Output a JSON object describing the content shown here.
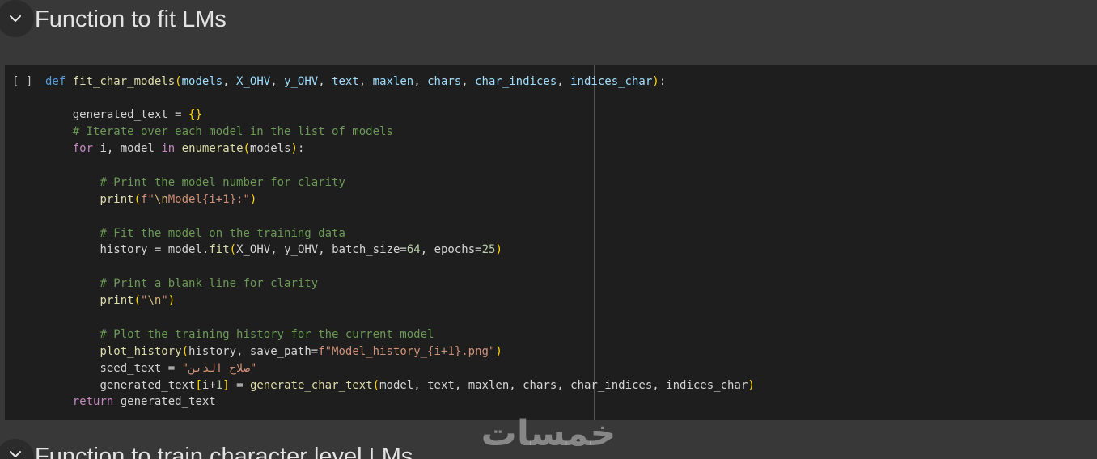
{
  "section": {
    "title": "Function to fit LMs",
    "toggle_icon": "chevron-down-icon"
  },
  "next_section": {
    "title": "Function to train character level LMs",
    "toggle_icon": "chevron-down-icon"
  },
  "cell": {
    "run_label": "[ ]",
    "lines": [
      [
        [
          "def",
          "#569cd6"
        ],
        [
          " ",
          "#d4d4d4"
        ],
        [
          "fit_char_models",
          "#dcdcaa"
        ],
        [
          "(",
          "#ffd700"
        ],
        [
          "models",
          "#9cdcfe"
        ],
        [
          ", ",
          "#d4d4d4"
        ],
        [
          "X_OHV",
          "#9cdcfe"
        ],
        [
          ", ",
          "#d4d4d4"
        ],
        [
          "y_OHV",
          "#9cdcfe"
        ],
        [
          ", ",
          "#d4d4d4"
        ],
        [
          "text",
          "#9cdcfe"
        ],
        [
          ", ",
          "#d4d4d4"
        ],
        [
          "maxlen",
          "#9cdcfe"
        ],
        [
          ", ",
          "#d4d4d4"
        ],
        [
          "chars",
          "#9cdcfe"
        ],
        [
          ", ",
          "#d4d4d4"
        ],
        [
          "char_indices",
          "#9cdcfe"
        ],
        [
          ", ",
          "#d4d4d4"
        ],
        [
          "indices_char",
          "#9cdcfe"
        ],
        [
          ")",
          "#ffd700"
        ],
        [
          ":",
          "#d4d4d4"
        ]
      ],
      [],
      [
        [
          "    ",
          "#d4d4d4"
        ],
        [
          "generated_text",
          "#d4d4d4"
        ],
        [
          " = ",
          "#d4d4d4"
        ],
        [
          "{}",
          "#ffd700"
        ]
      ],
      [
        [
          "    ",
          "#d4d4d4"
        ],
        [
          "# Iterate over each model in the list of models",
          "#6a9955"
        ]
      ],
      [
        [
          "    ",
          "#d4d4d4"
        ],
        [
          "for",
          "#c586c0"
        ],
        [
          " ",
          "#d4d4d4"
        ],
        [
          "i",
          "#d4d4d4"
        ],
        [
          ", ",
          "#d4d4d4"
        ],
        [
          "model",
          "#d4d4d4"
        ],
        [
          " ",
          "#d4d4d4"
        ],
        [
          "in",
          "#c586c0"
        ],
        [
          " ",
          "#d4d4d4"
        ],
        [
          "enumerate",
          "#dcdcaa"
        ],
        [
          "(",
          "#ffd700"
        ],
        [
          "models",
          "#d4d4d4"
        ],
        [
          ")",
          "#ffd700"
        ],
        [
          ":",
          "#d4d4d4"
        ]
      ],
      [],
      [
        [
          "        ",
          "#d4d4d4"
        ],
        [
          "# Print the model number for clarity",
          "#6a9955"
        ]
      ],
      [
        [
          "        ",
          "#d4d4d4"
        ],
        [
          "print",
          "#dcdcaa"
        ],
        [
          "(",
          "#ffd700"
        ],
        [
          "f\"",
          "#ce9178"
        ],
        [
          "\\n",
          "#d7ba7d"
        ],
        [
          "Model{i+1}:\"",
          "#ce9178"
        ],
        [
          ")",
          "#ffd700"
        ]
      ],
      [],
      [
        [
          "        ",
          "#d4d4d4"
        ],
        [
          "# Fit the model on the training data",
          "#6a9955"
        ]
      ],
      [
        [
          "        ",
          "#d4d4d4"
        ],
        [
          "history",
          "#d4d4d4"
        ],
        [
          " = ",
          "#d4d4d4"
        ],
        [
          "model",
          "#d4d4d4"
        ],
        [
          ".",
          "#d4d4d4"
        ],
        [
          "fit",
          "#dcdcaa"
        ],
        [
          "(",
          "#ffd700"
        ],
        [
          "X_OHV",
          "#d4d4d4"
        ],
        [
          ", ",
          "#d4d4d4"
        ],
        [
          "y_OHV",
          "#d4d4d4"
        ],
        [
          ", ",
          "#d4d4d4"
        ],
        [
          "batch_size",
          "#d4d4d4"
        ],
        [
          "=",
          "#d4d4d4"
        ],
        [
          "64",
          "#b5cea8"
        ],
        [
          ", ",
          "#d4d4d4"
        ],
        [
          "epochs",
          "#d4d4d4"
        ],
        [
          "=",
          "#d4d4d4"
        ],
        [
          "25",
          "#b5cea8"
        ],
        [
          ")",
          "#ffd700"
        ]
      ],
      [],
      [
        [
          "        ",
          "#d4d4d4"
        ],
        [
          "# Print a blank line for clarity",
          "#6a9955"
        ]
      ],
      [
        [
          "        ",
          "#d4d4d4"
        ],
        [
          "print",
          "#dcdcaa"
        ],
        [
          "(",
          "#ffd700"
        ],
        [
          "\"",
          "#ce9178"
        ],
        [
          "\\n",
          "#d7ba7d"
        ],
        [
          "\"",
          "#ce9178"
        ],
        [
          ")",
          "#ffd700"
        ]
      ],
      [],
      [
        [
          "        ",
          "#d4d4d4"
        ],
        [
          "# Plot the training history for the current model",
          "#6a9955"
        ]
      ],
      [
        [
          "        ",
          "#d4d4d4"
        ],
        [
          "plot_history",
          "#dcdcaa"
        ],
        [
          "(",
          "#ffd700"
        ],
        [
          "history",
          "#d4d4d4"
        ],
        [
          ", ",
          "#d4d4d4"
        ],
        [
          "save_path",
          "#d4d4d4"
        ],
        [
          "=",
          "#d4d4d4"
        ],
        [
          "f\"Model_history_{i+1}.png\"",
          "#ce9178"
        ],
        [
          ")",
          "#ffd700"
        ]
      ],
      [
        [
          "        ",
          "#d4d4d4"
        ],
        [
          "seed_text",
          "#d4d4d4"
        ],
        [
          " = ",
          "#d4d4d4"
        ],
        [
          "\"صلاح الدين\"",
          "#ce9178"
        ]
      ],
      [
        [
          "        ",
          "#d4d4d4"
        ],
        [
          "generated_text",
          "#d4d4d4"
        ],
        [
          "[",
          "#ffd700"
        ],
        [
          "i",
          "#d4d4d4"
        ],
        [
          "+",
          "#d4d4d4"
        ],
        [
          "1",
          "#b5cea8"
        ],
        [
          "]",
          "#ffd700"
        ],
        [
          " = ",
          "#d4d4d4"
        ],
        [
          "generate_char_text",
          "#dcdcaa"
        ],
        [
          "(",
          "#ffd700"
        ],
        [
          "model",
          "#d4d4d4"
        ],
        [
          ", ",
          "#d4d4d4"
        ],
        [
          "text",
          "#d4d4d4"
        ],
        [
          ", ",
          "#d4d4d4"
        ],
        [
          "maxlen",
          "#d4d4d4"
        ],
        [
          ", ",
          "#d4d4d4"
        ],
        [
          "chars",
          "#d4d4d4"
        ],
        [
          ", ",
          "#d4d4d4"
        ],
        [
          "char_indices",
          "#d4d4d4"
        ],
        [
          ", ",
          "#d4d4d4"
        ],
        [
          "indices_char",
          "#d4d4d4"
        ],
        [
          ")",
          "#ffd700"
        ]
      ],
      [
        [
          "    ",
          "#d4d4d4"
        ],
        [
          "return",
          "#c586c0"
        ],
        [
          " ",
          "#d4d4d4"
        ],
        [
          "generated_text",
          "#d4d4d4"
        ]
      ]
    ]
  },
  "watermark": {
    "text": "خمسات"
  },
  "theme": {
    "page_background": "#383838",
    "cell_background": "#1e1e1e",
    "heading_color": "#e3e3e3"
  }
}
